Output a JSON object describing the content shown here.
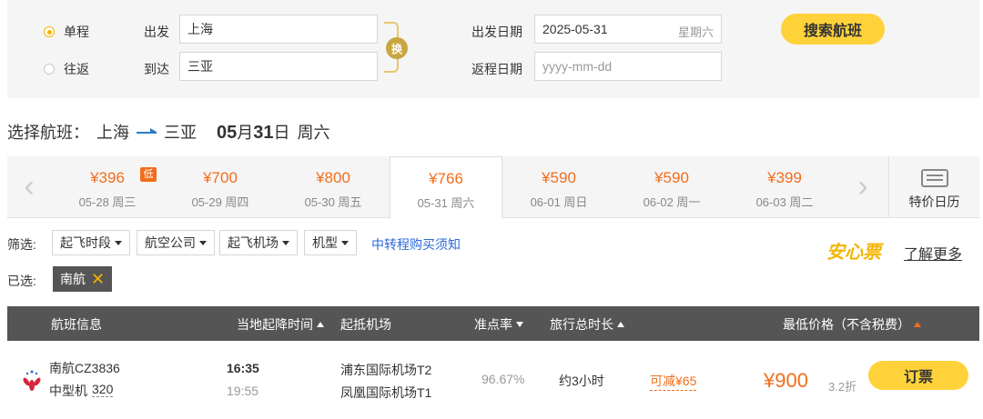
{
  "search": {
    "trip_types": [
      {
        "label": "单程",
        "selected": true
      },
      {
        "label": "往返",
        "selected": false
      }
    ],
    "from_label": "出发",
    "from_value": "上海",
    "to_label": "到达",
    "to_value": "三亚",
    "swap_label": "换",
    "depart_date_label": "出发日期",
    "depart_date_value": "2025-05-31",
    "depart_weekday": "星期六",
    "return_date_label": "返程日期",
    "return_date_placeholder": "yyyy-mm-dd",
    "search_button": "搜索航班"
  },
  "route": {
    "prefix": "选择航班：",
    "from": "上海",
    "to": "三亚",
    "month": "05",
    "month_unit": "月",
    "day": "31",
    "day_unit": "日",
    "weekday": "周六"
  },
  "date_strip": {
    "prev_icon": "chevron-left-icon",
    "next_icon": "chevron-right-icon",
    "dates": [
      {
        "price": "¥396",
        "day": "05-28 周三",
        "low": "低"
      },
      {
        "price": "¥700",
        "day": "05-29 周四"
      },
      {
        "price": "¥800",
        "day": "05-30 周五"
      },
      {
        "price": "¥766",
        "day": "05-31 周六",
        "active": true
      },
      {
        "price": "¥590",
        "day": "06-01 周日"
      },
      {
        "price": "¥590",
        "day": "06-02 周一"
      },
      {
        "price": "¥399",
        "day": "06-03 周二"
      }
    ],
    "calendar_label": "特价日历"
  },
  "filters": {
    "label": "筛选:",
    "dropdowns": [
      "起飞时段",
      "航空公司",
      "起飞机场",
      "机型"
    ],
    "transfer_link": "中转程购买须知",
    "assure_logo": "安心票",
    "learn_more": "了解更多",
    "selected_label": "已选:",
    "selected_tags": [
      "南航"
    ]
  },
  "table": {
    "headers": {
      "flight_info": "航班信息",
      "times": "当地起降时间",
      "airports": "起抵机场",
      "ontime": "准点率",
      "duration": "旅行总时长",
      "price": "最低价格（不含税费）"
    },
    "rows": [
      {
        "airline_flight": "南航CZ3836",
        "plane_size": "中型机",
        "plane_code": "320",
        "dep_time": "16:35",
        "arr_time": "19:55",
        "dep_airport": "浦东国际机场T2",
        "arr_airport": "凤凰国际机场T1",
        "ontime_rate": "96.67%",
        "duration": "约3小时",
        "discount": "可减¥65",
        "price": "¥900",
        "off_rate": "3.2折",
        "book_label": "订票"
      }
    ]
  },
  "colors": {
    "accent_orange": "#f26d1b",
    "button_yellow": "#ffd23a",
    "link_blue": "#2a6ad6",
    "header_gray": "#555555"
  }
}
